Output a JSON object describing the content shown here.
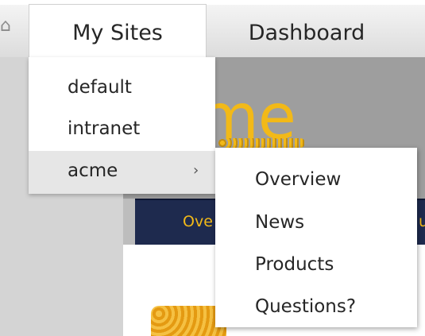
{
  "topnav": {
    "home_glyph": "⌂",
    "tabs": [
      {
        "label": "My Sites"
      },
      {
        "label": "Dashboard"
      }
    ]
  },
  "my_sites_menu": {
    "items": [
      {
        "label": "default"
      },
      {
        "label": "intranet"
      },
      {
        "label": "acme",
        "has_submenu": true,
        "chevron": "›"
      }
    ]
  },
  "acme_submenu": {
    "items": [
      {
        "label": "Overview"
      },
      {
        "label": "News"
      },
      {
        "label": "Products"
      },
      {
        "label": "Questions?"
      }
    ]
  },
  "background_site": {
    "logo_text": "cme",
    "nav_fragment_left": "Ove",
    "nav_fragment_right": "u",
    "colors": {
      "brand_yellow": "#f2b918",
      "nav_navy": "#1e2a4e",
      "header_gray": "#9e9e9e"
    }
  }
}
